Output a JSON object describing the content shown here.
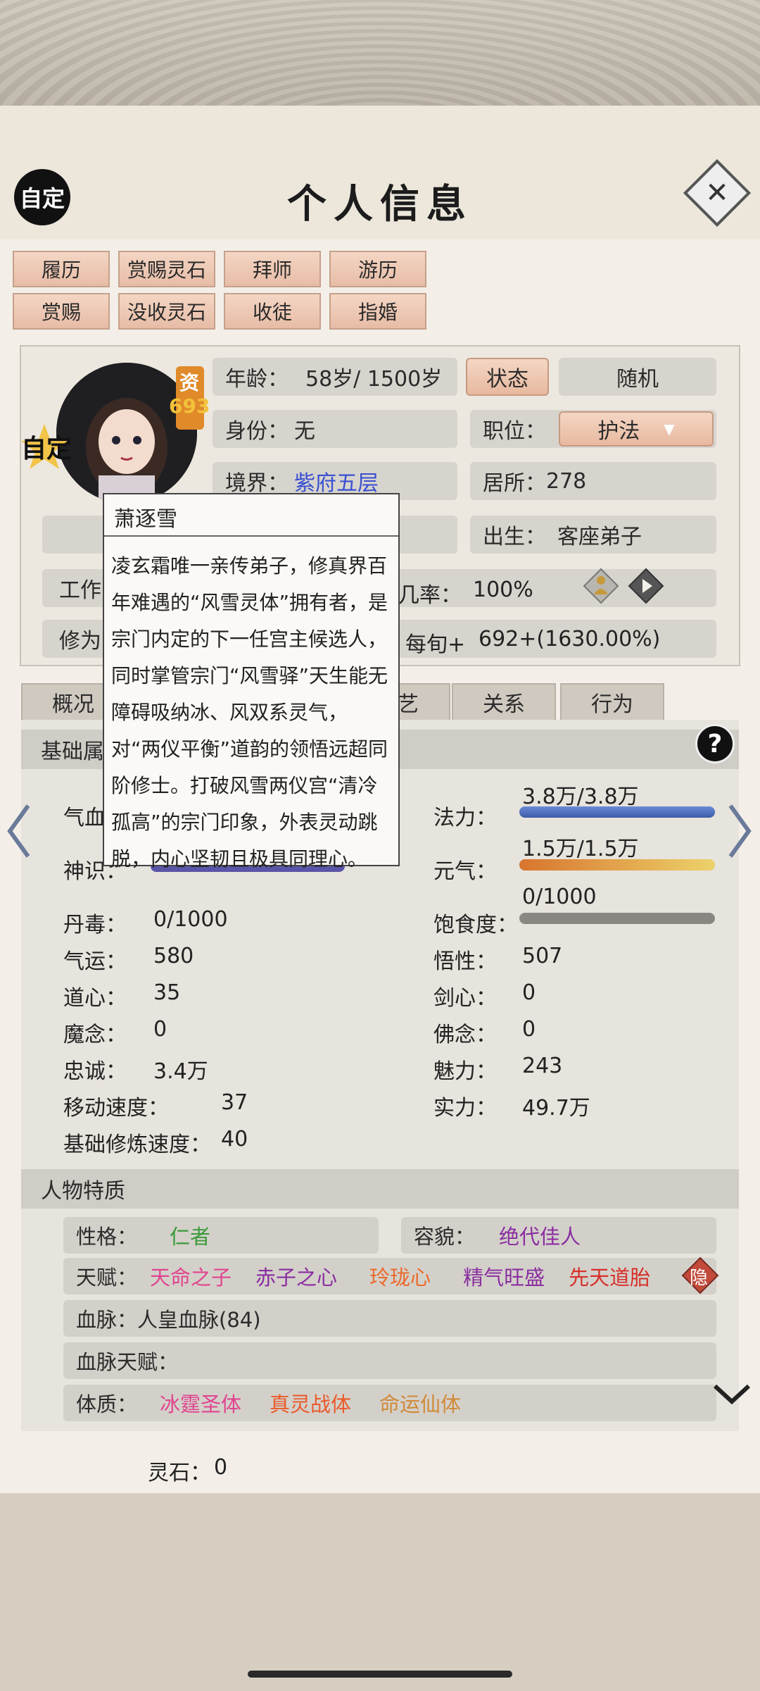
{
  "header": {
    "title": "个人信息",
    "custom_label": "自定",
    "close_label": "✕"
  },
  "action_buttons": [
    "履历",
    "赏赐灵石",
    "拜师",
    "游历",
    "赏赐",
    "没收灵石",
    "收徒",
    "指婚"
  ],
  "profile": {
    "avatar_badge": "自定",
    "aptitude_label": "资",
    "aptitude_value": "693",
    "age_label": "年龄：",
    "age_value": "58岁/ 1500岁",
    "state_button": "状态",
    "random_button": "随机",
    "identity_label": "身份：",
    "identity_value": "无",
    "position_label": "职位：",
    "position_value": "护法",
    "realm_label": "境界：",
    "realm_value": "紫府五层",
    "residence_label": "居所：",
    "residence_value": "278",
    "birth_label": "出生：",
    "birth_value": "客座弟子",
    "work_label": "工作",
    "rate_label": "几率：",
    "rate_value": "100%",
    "cultivation_label": "修为",
    "per_turn_label": "每旬+",
    "per_turn_value": "692+(1630.00%)"
  },
  "tabs": [
    "概况",
    "艺",
    "关系",
    "行为"
  ],
  "basic_section": {
    "title": "基础属",
    "help": "?",
    "qixue_label": "气血",
    "shenshi_label": "神识：",
    "fali_label": "法力：",
    "fali_value": "3.8万/3.8万",
    "fali_fill": 1.0,
    "yuanqi_label": "元气：",
    "yuanqi_value": "1.5万/1.5万",
    "yuanqi_fill": 1.0,
    "baoshi_label": "饱食度：",
    "baoshi_value": "0/1000",
    "baoshi_fill": 0.0,
    "left_stats": [
      {
        "label": "丹毒：",
        "value": "0/1000"
      },
      {
        "label": "气运：",
        "value": "580"
      },
      {
        "label": "道心：",
        "value": "35"
      },
      {
        "label": "魔念：",
        "value": "0"
      },
      {
        "label": "忠诚：",
        "value": "3.4万"
      },
      {
        "label": "移动速度：",
        "value": "37"
      },
      {
        "label": "基础修炼速度：",
        "value": "40"
      }
    ],
    "right_stats": [
      {
        "label": "悟性：",
        "value": "507"
      },
      {
        "label": "剑心：",
        "value": "0"
      },
      {
        "label": "佛念：",
        "value": "0"
      },
      {
        "label": "魅力：",
        "value": "243"
      },
      {
        "label": "实力：",
        "value": "49.7万"
      }
    ]
  },
  "traits_section": {
    "title": "人物特质",
    "personality_label": "性格：",
    "personality_value": "仁者",
    "looks_label": "容貌：",
    "looks_value": "绝代佳人",
    "talent_label": "天赋：",
    "talents": [
      {
        "text": "天命之子",
        "color": "#e0458f"
      },
      {
        "text": "赤子之心",
        "color": "#8a2ea0"
      },
      {
        "text": "玲珑心",
        "color": "#ea6a2a"
      },
      {
        "text": "精气旺盛",
        "color": "#8a2ea0"
      },
      {
        "text": "先天道胎",
        "color": "#d6302a"
      }
    ],
    "hidden_label": "隐",
    "bloodline_label": "血脉：",
    "bloodline_value": "人皇血脉(84)",
    "bloodline_talent_label": "血脉天赋：",
    "physique_label": "体质：",
    "physiques": [
      {
        "text": "冰霆圣体",
        "color": "#e0458f"
      },
      {
        "text": "真灵战体",
        "color": "#ea5a2a"
      },
      {
        "text": "命运仙体",
        "color": "#d08a3a"
      }
    ]
  },
  "spirit_stone": {
    "label": "灵石：",
    "value": "0"
  },
  "tooltip": {
    "name": "萧逐雪",
    "text": "凌玄霜唯一亲传弟子，修真界百年难遇的“风雪灵体”拥有者，是宗门内定的下一任宫主候选人，同时掌管宗门“风雪驿”天生能无障碍吸纳冰、风双系灵气，对“两仪平衡”道韵的领悟远超同阶修士。打破风雪两仪宫“清冷孤高”的宗门印象，外表灵动跳脱，内心坚韧且极具同理心。"
  },
  "colors": {
    "button": "#e9c0aa",
    "fali_bar": "#4a6ab8",
    "yuanqi_bar": "#e0a050",
    "realm_text": "#3a4fd0",
    "personality_text": "#3a9a3a",
    "looks_text": "#8a2ea0"
  },
  "icons": [
    "close-icon",
    "help-icon",
    "left-arrow-icon",
    "right-arrow-icon",
    "play-icon",
    "figure-icon",
    "chevron-down-icon",
    "dropdown-arrow-icon"
  ]
}
